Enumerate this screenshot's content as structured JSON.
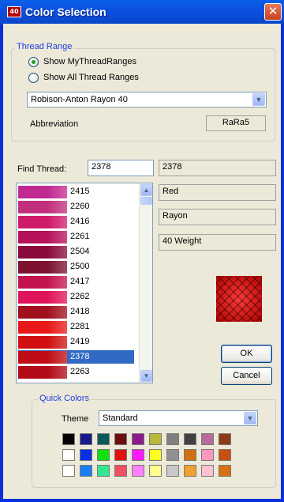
{
  "window": {
    "title": "Color Selection",
    "app_icon_text": "40",
    "close_glyph": "✕"
  },
  "thread_range": {
    "legend": "Thread Range",
    "options": [
      {
        "label": "Show MyThreadRanges",
        "checked": true
      },
      {
        "label": "Show All Thread Ranges",
        "checked": false
      }
    ],
    "selected_range": "Robison-Anton Rayon 40",
    "abbreviation_label": "Abbreviation",
    "abbreviation_value": "RaRa5"
  },
  "find": {
    "label": "Find Thread:",
    "value": "2378",
    "result_number": "2378",
    "result_color": "Red",
    "result_material": "Rayon",
    "result_weight": "40 Weight"
  },
  "threads": [
    {
      "code": "2415",
      "color": "#c02a90"
    },
    {
      "code": "2260",
      "color": "#c0307c"
    },
    {
      "code": "2416",
      "color": "#cf1a6a"
    },
    {
      "code": "2261",
      "color": "#b6125a"
    },
    {
      "code": "2504",
      "color": "#8a0a3c"
    },
    {
      "code": "2500",
      "color": "#7c1230"
    },
    {
      "code": "2417",
      "color": "#c41450"
    },
    {
      "code": "2262",
      "color": "#e0145a"
    },
    {
      "code": "2418",
      "color": "#a0101c"
    },
    {
      "code": "2281",
      "color": "#e81818"
    },
    {
      "code": "2419",
      "color": "#d01010"
    },
    {
      "code": "2378",
      "color": "#c00c14",
      "selected": true
    },
    {
      "code": "2263",
      "color": "#b20a16"
    }
  ],
  "buttons": {
    "ok": "OK",
    "cancel": "Cancel"
  },
  "quick_colors": {
    "legend": "Quick Colors",
    "theme_label": "Theme",
    "theme_value": "Standard",
    "grid": [
      [
        "#000000",
        "#1a1a8c",
        "#0a5a5a",
        "#6b0f0f",
        "#8b1a8b",
        "#b8b83a",
        "#808080",
        "#404040",
        "#b86a9a",
        "#8b3a1a"
      ],
      [
        "#ffffff",
        "#0a2ee0",
        "#10e010",
        "#e01010",
        "#ff1aff",
        "#ffff20",
        "#909090",
        "#d07010",
        "#ff98c0",
        "#c85010"
      ],
      [
        "#ffffff",
        "#1a7ef0",
        "#30e890",
        "#f05060",
        "#ff80ff",
        "#ffff90",
        "#c8c8c8",
        "#f0a030",
        "#ffc0d0",
        "#d87018"
      ]
    ]
  },
  "icons": {
    "combo_arrow": "chevron-down-icon",
    "scroll_up": "chevron-up-icon",
    "scroll_down": "chevron-down-icon"
  }
}
